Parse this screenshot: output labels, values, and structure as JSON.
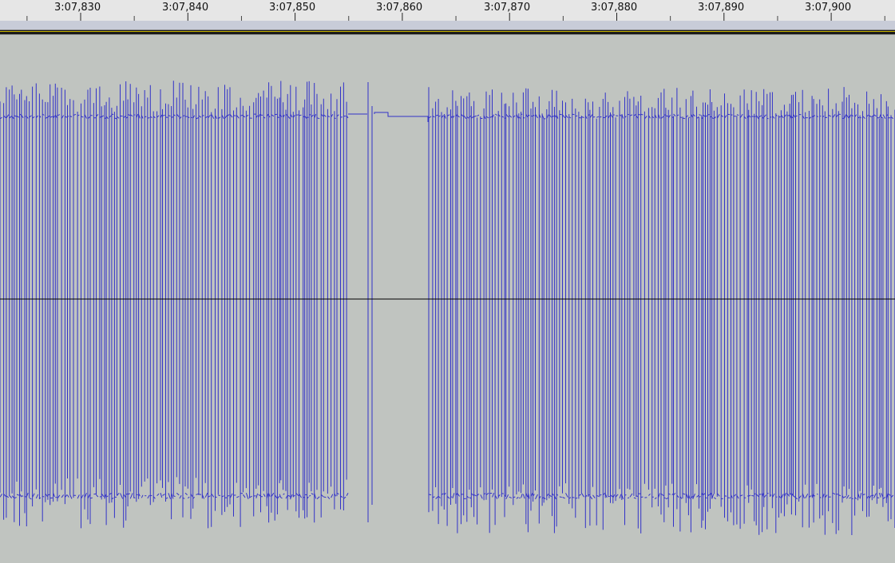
{
  "timeline": {
    "labels": [
      "3:07,830",
      "3:07,840",
      "3:07,850",
      "3:07,860",
      "3:07,870",
      "3:07,880",
      "3:07,890",
      "3:07,900"
    ]
  },
  "colors": {
    "waveform": "#3232c8",
    "zero_line": "#000000",
    "background": "#c0c4c0",
    "ruler": "#e6e6e6"
  },
  "waveform": {
    "gap": "silence between bursts near 3:07,857"
  }
}
